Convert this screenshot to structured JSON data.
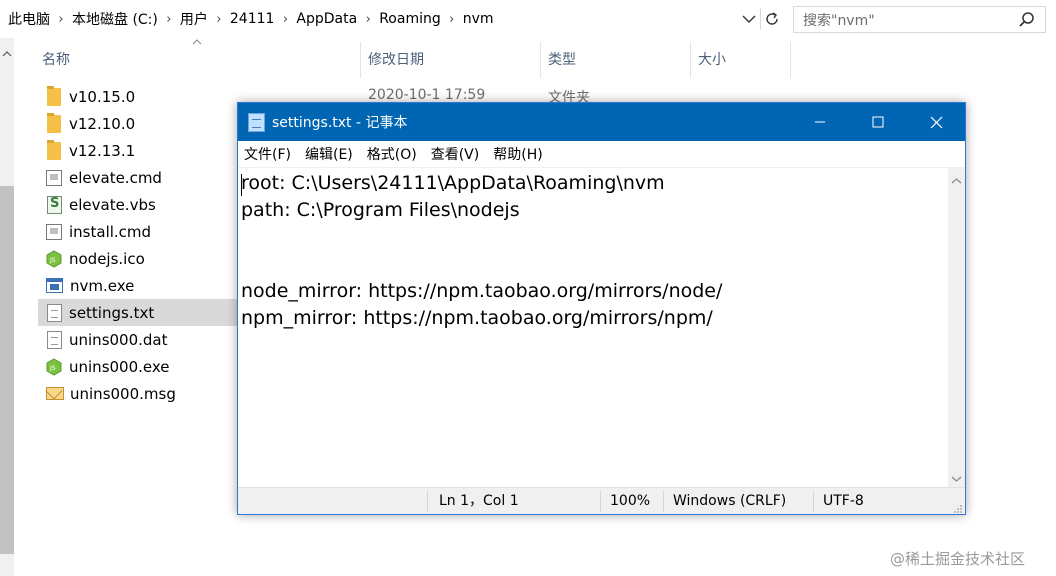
{
  "explorer": {
    "breadcrumb": [
      "此电脑",
      "本地磁盘 (C:)",
      "用户",
      "24111",
      "AppData",
      "Roaming",
      "nvm"
    ],
    "search_placeholder": "搜索\"nvm\"",
    "columns": {
      "name": "名称",
      "date_modified": "修改日期",
      "type": "类型",
      "size": "大小"
    },
    "first_row_date": "2020-10-1 17:59",
    "first_row_type": "文件夹",
    "files": [
      {
        "name": "v10.15.0",
        "icon": "folder-icon"
      },
      {
        "name": "v12.10.0",
        "icon": "folder-icon"
      },
      {
        "name": "v12.13.1",
        "icon": "folder-icon"
      },
      {
        "name": "elevate.cmd",
        "icon": "cmd-file-icon"
      },
      {
        "name": "elevate.vbs",
        "icon": "vbs-file-icon"
      },
      {
        "name": "install.cmd",
        "icon": "cmd-file-icon"
      },
      {
        "name": "nodejs.ico",
        "icon": "nodejs-icon"
      },
      {
        "name": "nvm.exe",
        "icon": "exe-file-icon"
      },
      {
        "name": "settings.txt",
        "icon": "text-file-icon",
        "selected": true
      },
      {
        "name": "unins000.dat",
        "icon": "text-file-icon"
      },
      {
        "name": "unins000.exe",
        "icon": "nodejs-icon"
      },
      {
        "name": "unins000.msg",
        "icon": "msg-file-icon"
      }
    ]
  },
  "notepad": {
    "title": "settings.txt - 记事本",
    "menu": [
      "文件(F)",
      "编辑(E)",
      "格式(O)",
      "查看(V)",
      "帮助(H)"
    ],
    "content_lines": [
      "root: C:\\Users\\24111\\AppData\\Roaming\\nvm",
      "path: C:\\Program Files\\nodejs",
      "",
      "",
      "node_mirror: https://npm.taobao.org/mirrors/node/",
      "npm_mirror: https://npm.taobao.org/mirrors/npm/"
    ],
    "status": {
      "position": "Ln 1，Col 1",
      "zoom": "100%",
      "line_ending": "Windows (CRLF)",
      "encoding": "UTF-8"
    },
    "colors": {
      "titlebar": "#0066b4",
      "title_text": "#ffffff"
    }
  },
  "watermark": "@稀土掘金技术社区"
}
